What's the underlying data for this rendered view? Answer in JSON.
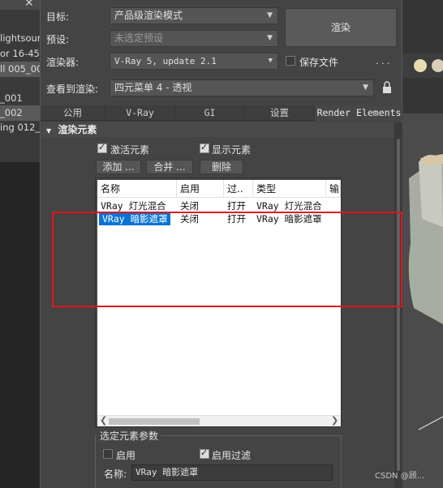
{
  "scene_explorer": {
    "items": [
      "lightsourc",
      "or 16-45_",
      "ll 005_00",
      "_001",
      "_002",
      "ing 012_"
    ]
  },
  "dialog": {
    "target_label": "目标:",
    "target_value": "产品级渲染模式",
    "preset_label": "预设:",
    "preset_value": "未选定预设",
    "renderer_label": "渲染器:",
    "renderer_value": "V-Ray 5, update 2.1",
    "save_file_label": "保存文件",
    "save_file_dots": "...",
    "view_label": "查看到渲染:",
    "view_value": "四元菜单 4 - 透视",
    "render_button": "渲染"
  },
  "tabs": [
    "公用",
    "V-Ray",
    "GI",
    "设置",
    "Render Elements"
  ],
  "active_tab_index": 4,
  "rollout": {
    "title": "渲染元素",
    "activate_elements": "激活元素",
    "show_elements": "显示元素",
    "add_button": "添加 ...",
    "merge_button": "合并 ...",
    "delete_button": "删除"
  },
  "list": {
    "columns": [
      "名称",
      "启用",
      "过..",
      "类型",
      "输"
    ],
    "rows": [
      {
        "name": "VRay 灯光混合",
        "enabled": "关闭",
        "filter": "打开",
        "type": "VRay 灯光混合",
        "selected": false
      },
      {
        "name": "VRay 暗影遮罩",
        "enabled": "关闭",
        "filter": "打开",
        "type": "VRay 暗影遮罩",
        "selected": true
      }
    ]
  },
  "selected_params": {
    "title": "选定元素参数",
    "enable_label": "启用",
    "enable_filter_label": "启用过滤",
    "name_label": "名称:",
    "name_value": "VRay 暗影遮罩"
  },
  "watermark": "CSDN @顾..."
}
